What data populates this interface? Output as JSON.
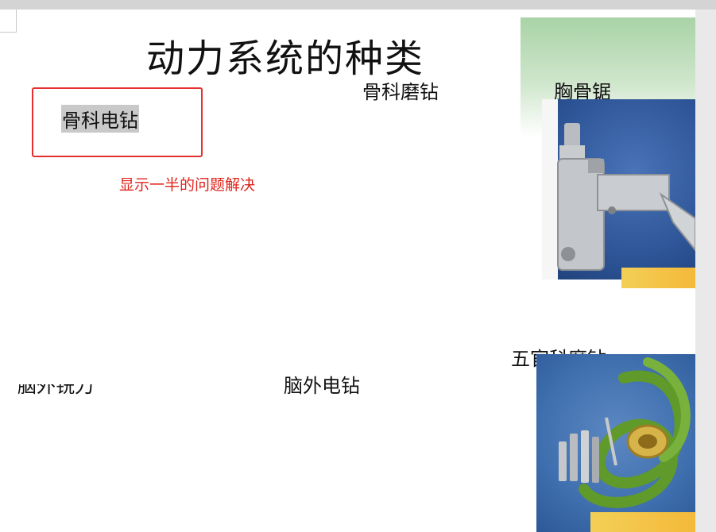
{
  "slide": {
    "title": "动力系统的种类",
    "labels": {
      "bone_grinding_drill": "骨科磨钻",
      "sternal_saw": "胸骨锯",
      "orthopedic_electric_drill": "骨科电钻",
      "ent_grinding_drill": "五官科磨钻",
      "neuro_electric_drill": "脑外电钻",
      "cropped_label": "脑外铣刀"
    },
    "annotation": "显示一半的问题解决"
  },
  "colors": {
    "annotation_red": "#e0241b",
    "box_red": "#e53030",
    "highlight_gray": "#c9c9c9",
    "green_header": "#a9d3a6",
    "photo_blue": "#2d5597",
    "accent_yellow": "#f4c145"
  }
}
